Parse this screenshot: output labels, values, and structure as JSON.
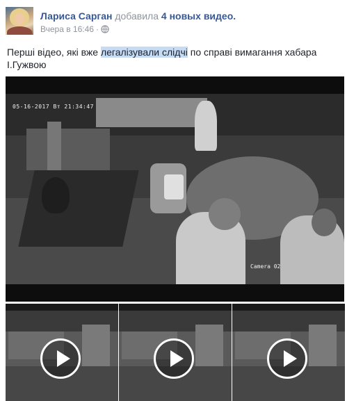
{
  "post": {
    "author": "Лариса Сарган",
    "verb": "добавила",
    "videos_link": "4 новых видео.",
    "timestamp": "Вчера в 16:46",
    "separator": "·",
    "privacy_icon": "globe-icon",
    "text_before": "Перші відео, які вже ",
    "text_highlight": "легалізували слідчі",
    "text_after": " по справі вимагання хабара І.Гужвою"
  },
  "main_video": {
    "overlay_timestamp": "05-16-2017 Вт 21:34:47",
    "camera_label": "Camera 02"
  },
  "thumbnails": [
    {
      "icon": "play-icon"
    },
    {
      "icon": "play-icon"
    },
    {
      "icon": "play-icon"
    }
  ],
  "colors": {
    "link": "#365899",
    "meta": "#90949c",
    "text": "#1d2129",
    "highlight": "#c6dcf5"
  }
}
